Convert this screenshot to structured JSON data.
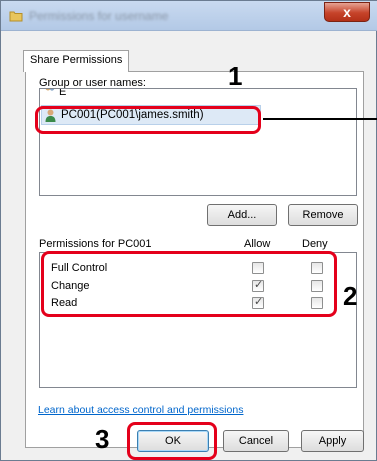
{
  "window": {
    "title": "Permissions for username",
    "close_glyph": "x"
  },
  "tab": {
    "label": "Share Permissions"
  },
  "group": {
    "label": "Group or user names:",
    "partial_item": "E",
    "selected_item": "PC001(PC001\\james.smith)"
  },
  "buttons": {
    "add": "Add...",
    "remove": "Remove",
    "ok": "OK",
    "cancel": "Cancel",
    "apply": "Apply"
  },
  "permissions": {
    "header": "Permissions for PC001",
    "allow_header": "Allow",
    "deny_header": "Deny",
    "rows": [
      {
        "name": "Full Control",
        "allow": false,
        "deny": false
      },
      {
        "name": "Change",
        "allow": true,
        "deny": false
      },
      {
        "name": "Read",
        "allow": true,
        "deny": false
      }
    ]
  },
  "link": {
    "text": "Learn about access control and permissions"
  },
  "annotations": {
    "step1": "1",
    "step2": "2",
    "step3": "3",
    "highlight_color": "#e4001b"
  },
  "icons": {
    "title_icon": "folder-icon",
    "user_icon": "user-icon"
  }
}
